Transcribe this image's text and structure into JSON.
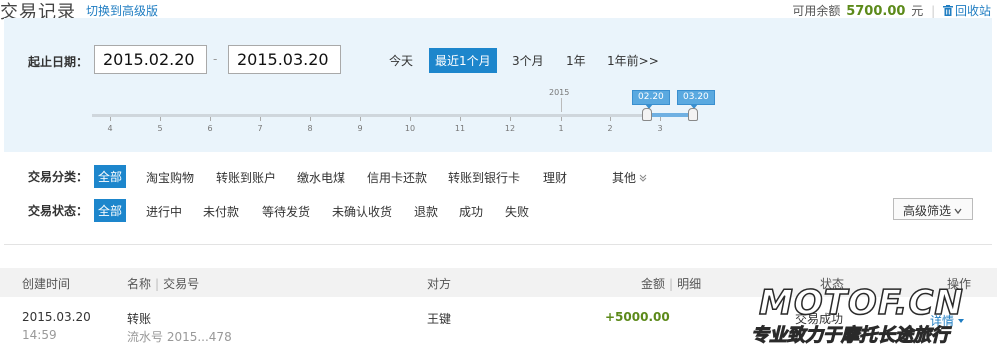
{
  "header": {
    "title": "交易记录",
    "switch_link": "切换到高级版",
    "balance_label": "可用余额",
    "balance_amount": "5700.00",
    "balance_unit": "元",
    "recycle_label": "回收站"
  },
  "filter": {
    "date_label": "起止日期：",
    "start_date": "2015.02.20",
    "end_date": "2015.03.20",
    "date_separator": "-",
    "quick_ranges": [
      "今天",
      "最近1个月",
      "3个月",
      "1年",
      "1年前>>"
    ],
    "active_quick_range": "最近1个月",
    "slider": {
      "year_label": "2015",
      "ticks": [
        "4",
        "5",
        "6",
        "7",
        "8",
        "9",
        "10",
        "11",
        "12",
        "1",
        "2",
        "3"
      ],
      "start_flag": "02.20",
      "end_flag": "03.20"
    },
    "category_label": "交易分类：",
    "categories": [
      "全部",
      "淘宝购物",
      "转账到账户",
      "缴水电煤",
      "信用卡还款",
      "转账到银行卡",
      "理财"
    ],
    "category_more": "其他",
    "status_label": "交易状态：",
    "statuses": [
      "全部",
      "进行中",
      "未付款",
      "等待发货",
      "未确认收货",
      "退款",
      "成功",
      "失败"
    ],
    "advanced_filter": "高级筛选"
  },
  "table": {
    "headers": {
      "created": "创建时间",
      "name": "名称",
      "tx_no": "交易号",
      "counterparty": "对方",
      "amount": "金额",
      "detail": "明细",
      "status": "状态",
      "action": "操作"
    },
    "rows": [
      {
        "date": "2015.03.20",
        "time": "14:59",
        "name": "转账",
        "serial": "流水号 2015...478",
        "counterparty": "王键",
        "amount": "+5000.00",
        "status": "交易成功",
        "action": "详情"
      }
    ]
  },
  "watermark": {
    "main": "MOTOF.CN",
    "sub": "专业致力于摩托长途旅行"
  },
  "colors": {
    "accent": "#1d86cc",
    "panel_bg": "#eaf4fb",
    "positive": "#5c8a1a"
  }
}
